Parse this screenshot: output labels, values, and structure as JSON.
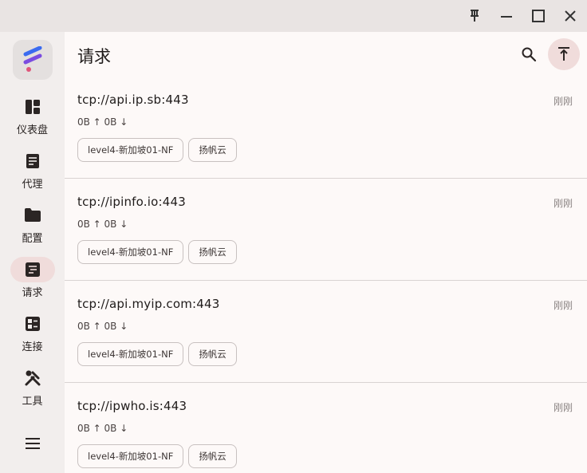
{
  "window": {
    "buttons": [
      "pin-icon",
      "minimize-icon",
      "maximize-icon",
      "close-icon"
    ]
  },
  "sidebar": {
    "items": [
      {
        "label": "仪表盘",
        "icon": "dashboard-icon",
        "active": false
      },
      {
        "label": "代理",
        "icon": "article-icon",
        "active": false
      },
      {
        "label": "配置",
        "icon": "folder-icon",
        "active": false
      },
      {
        "label": "请求",
        "icon": "requests-icon",
        "active": true
      },
      {
        "label": "连接",
        "icon": "connections-icon",
        "active": false
      },
      {
        "label": "工具",
        "icon": "tools-icon",
        "active": false
      }
    ]
  },
  "header": {
    "title": "请求"
  },
  "colors": {
    "accent_pill": "#f0dcdb",
    "titlebar": "#e9e4e3",
    "sidebar": "#f2eeed",
    "logo_blue": "#3b6bf0",
    "logo_purple": "#7b4ce0",
    "logo_pink": "#e0557a"
  },
  "requests": [
    {
      "host": "tcp://api.ip.sb:443",
      "time": "刚刚",
      "traffic": "0B ↑ 0B ↓",
      "tags": [
        "level4-新加坡01-NF",
        "扬帆云"
      ]
    },
    {
      "host": "tcp://ipinfo.io:443",
      "time": "刚刚",
      "traffic": "0B ↑ 0B ↓",
      "tags": [
        "level4-新加坡01-NF",
        "扬帆云"
      ]
    },
    {
      "host": "tcp://api.myip.com:443",
      "time": "刚刚",
      "traffic": "0B ↑ 0B ↓",
      "tags": [
        "level4-新加坡01-NF",
        "扬帆云"
      ]
    },
    {
      "host": "tcp://ipwho.is:443",
      "time": "刚刚",
      "traffic": "0B ↑ 0B ↓",
      "tags": [
        "level4-新加坡01-NF",
        "扬帆云"
      ]
    }
  ]
}
